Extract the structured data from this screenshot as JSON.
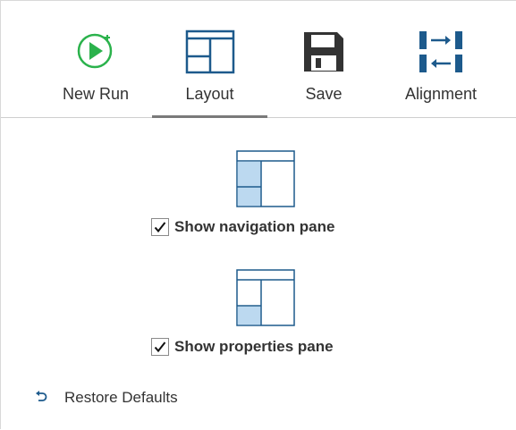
{
  "ribbon": {
    "tabs": [
      {
        "label": "New Run",
        "icon": "new-run-play-icon"
      },
      {
        "label": "Layout",
        "icon": "layout-icon",
        "active": true
      },
      {
        "label": "Save",
        "icon": "floppy-disk-icon"
      },
      {
        "label": "Alignment",
        "icon": "alignment-icon"
      }
    ]
  },
  "layout_options": {
    "navigation_pane": {
      "label": "Show navigation pane",
      "checked": true,
      "icon": "navigation-pane-layout-icon"
    },
    "properties_pane": {
      "label": "Show properties pane",
      "checked": true,
      "icon": "properties-pane-layout-icon"
    }
  },
  "restore": {
    "label": "Restore Defaults",
    "icon": "undo-icon"
  },
  "colors": {
    "accent_green": "#2bb24c",
    "icon_blue": "#1d5a8c",
    "pane_highlight": "#bcd9f0",
    "active_underline": "#7a7a7a"
  }
}
